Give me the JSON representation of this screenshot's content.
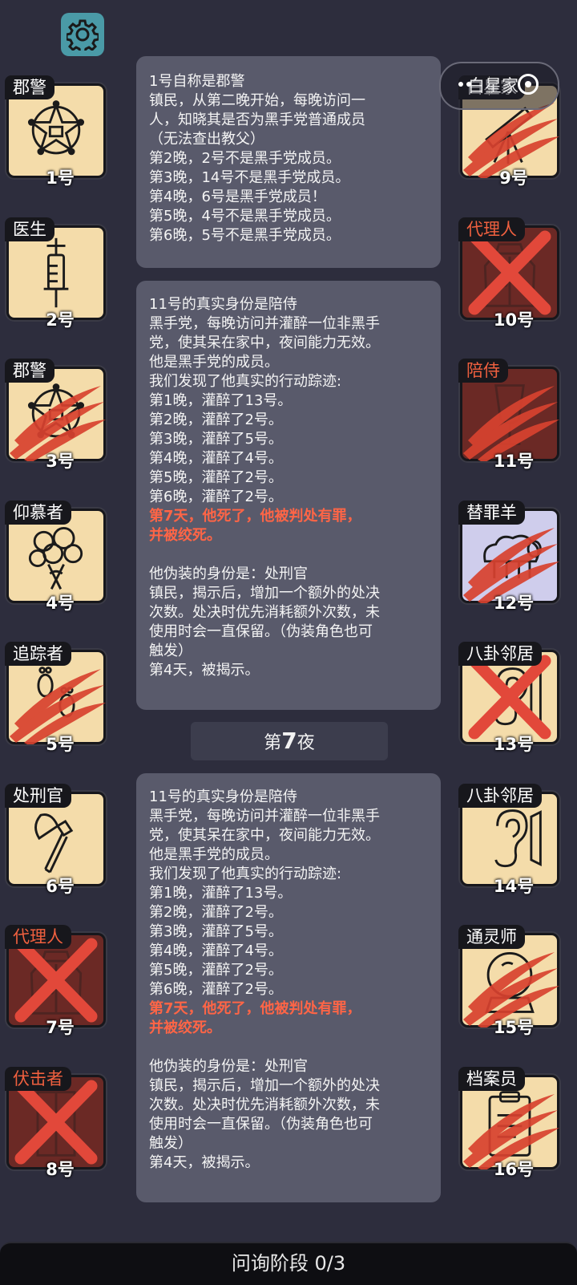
{
  "settings": {
    "icon": "gear-icon"
  },
  "capsule": {
    "overlay_text": "白星家",
    "icons": [
      "more-icon",
      "close-target-icon"
    ]
  },
  "players_left": [
    {
      "role": "郡警",
      "number": "1号",
      "icon": "sheriff-star-icon",
      "state": "alive"
    },
    {
      "role": "医生",
      "number": "2号",
      "icon": "syringe-icon",
      "state": "alive"
    },
    {
      "role": "郡警",
      "number": "3号",
      "icon": "sheriff-star-icon",
      "state": "clawed"
    },
    {
      "role": "仰慕者",
      "number": "4号",
      "icon": "bouquet-icon",
      "state": "alive"
    },
    {
      "role": "追踪者",
      "number": "5号",
      "icon": "footprints-icon",
      "state": "clawed"
    },
    {
      "role": "处刑官",
      "number": "6号",
      "icon": "axe-icon",
      "state": "alive"
    },
    {
      "role": "代理人",
      "number": "7号",
      "icon": "coat-icon",
      "state": "crossed"
    },
    {
      "role": "伏击者",
      "number": "8号",
      "icon": "door-icon",
      "state": "crossed"
    }
  ],
  "players_right": [
    {
      "role": "白星家",
      "number": "9号",
      "icon": "telescope-icon",
      "state": "clawed"
    },
    {
      "role": "代理人",
      "number": "10号",
      "icon": "coat-icon",
      "state": "crossed"
    },
    {
      "role": "陪侍",
      "number": "11号",
      "icon": "glass-icon",
      "state": "clawed"
    },
    {
      "role": "替罪羊",
      "number": "12号",
      "icon": "sheep-icon",
      "state": "clawed"
    },
    {
      "role": "八卦邻居",
      "number": "13号",
      "icon": "ear-icon",
      "state": "crossed"
    },
    {
      "role": "八卦邻居",
      "number": "14号",
      "icon": "ear-icon",
      "state": "alive"
    },
    {
      "role": "通灵师",
      "number": "15号",
      "icon": "crystal-ball-icon",
      "state": "clawed"
    },
    {
      "role": "档案员",
      "number": "16号",
      "icon": "clipboard-icon",
      "state": "clawed"
    }
  ],
  "log": {
    "sheriff_block": [
      "1号自称是郡警",
      "镇民，从第二晚开始，每晚访问一",
      "人，知晓其是否为黑手党普通成员",
      "（无法查出教父）",
      "第2晚，2号不是黑手党成员。",
      "第3晚，14号不是黑手党成员。",
      "第4晚，6号是黑手党成员！",
      "第5晚，4号不是黑手党成员。",
      "第6晚，5号不是黑手党成员。"
    ],
    "escort_block_1": {
      "lines": [
        "11号的真实身份是陪侍",
        "黑手党，每晚访问并灌醉一位非黑手",
        "党，使其呆在家中，夜间能力无效。",
        "他是黑手党的成员。",
        "我们发现了他真实的行动踪迹:",
        "第1晚，灌醉了13号。",
        "第2晚，灌醉了2号。",
        "第3晚，灌醉了5号。",
        "第4晚，灌醉了4号。",
        "第5晚，灌醉了2号。",
        "第6晚，灌醉了2号。"
      ],
      "death": [
        "第7天，他死了，他被判处有罪，",
        "并被绞死。"
      ],
      "disguise": [
        "他伪装的身份是：处刑官",
        "镇民，揭示后，增加一个额外的处决",
        "次数。处决时优先消耗额外次数，未",
        "使用时会一直保留。（伪装角色也可",
        "触发）",
        "第4天，被揭示。"
      ]
    },
    "night_divider": {
      "prefix": "第",
      "number": "7",
      "suffix": "夜"
    },
    "escort_block_2": {
      "lines": [
        "11号的真实身份是陪侍",
        "黑手党，每晚访问并灌醉一位非黑手",
        "党，使其呆在家中，夜间能力无效。",
        "他是黑手党的成员。",
        "我们发现了他真实的行动踪迹:",
        "第1晚，灌醉了13号。",
        "第2晚，灌醉了2号。",
        "第3晚，灌醉了5号。",
        "第4晚，灌醉了4号。",
        "第5晚，灌醉了2号。",
        "第6晚，灌醉了2号。"
      ],
      "death": [
        "第7天，他死了，他被判处有罪，",
        "并被绞死。"
      ],
      "disguise": [
        "他伪装的身份是：处刑官",
        "镇民，揭示后，增加一个额外的处决",
        "次数。处决时优先消耗额外次数，未",
        "使用时会一直保留。（伪装角色也可",
        "触发）",
        "第4天，被揭示。"
      ]
    }
  },
  "footer": {
    "phase": "问询阶段 0/3"
  },
  "colors": {
    "background": "#2d2d3d",
    "panel": "#595a6b",
    "card_cream": "#f4dcaa",
    "card_dead": "#6b2925",
    "highlight": "#ff6546",
    "cross": "#e2483a"
  }
}
